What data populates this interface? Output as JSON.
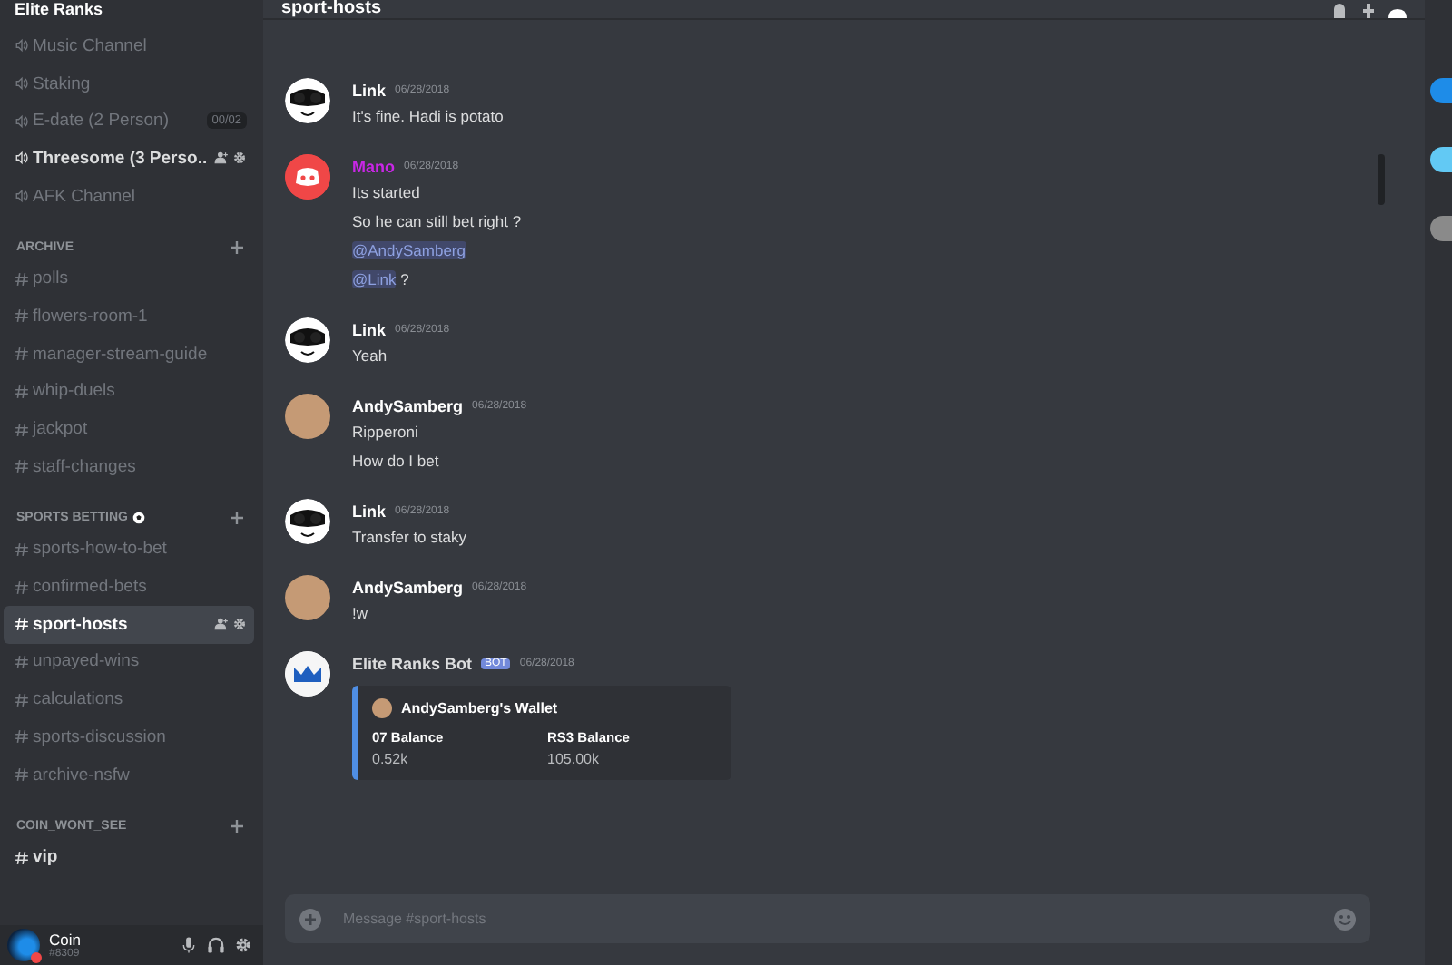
{
  "server": {
    "name": "Elite Ranks"
  },
  "categories": [
    {
      "channels": [
        {
          "kind": "voice",
          "name": "Music Channel",
          "selected": false,
          "bright": false
        },
        {
          "kind": "voice",
          "name": "Staking",
          "selected": false,
          "bright": false
        },
        {
          "kind": "voice",
          "name": "E-date (2 Person)",
          "selected": false,
          "bright": false,
          "count": "00/02"
        },
        {
          "kind": "voice",
          "name": "Threesome (3 Perso..",
          "selected": false,
          "bright": true,
          "tools": true
        },
        {
          "kind": "voice",
          "name": "AFK Channel",
          "selected": false,
          "bright": false
        }
      ]
    },
    {
      "name": "ARCHIVE",
      "channels": [
        {
          "kind": "text",
          "name": "polls",
          "selected": false,
          "bright": false
        },
        {
          "kind": "text",
          "name": "flowers-room-1",
          "selected": false,
          "bright": false
        },
        {
          "kind": "text",
          "name": "manager-stream-guide",
          "selected": false,
          "bright": false
        },
        {
          "kind": "text",
          "name": "whip-duels",
          "selected": false,
          "bright": false
        },
        {
          "kind": "text",
          "name": "jackpot",
          "selected": false,
          "bright": false
        },
        {
          "kind": "text",
          "name": "staff-changes",
          "selected": false,
          "bright": false
        }
      ]
    },
    {
      "name": "SPORTS BETTING",
      "ball": true,
      "channels": [
        {
          "kind": "text",
          "name": "sports-how-to-bet",
          "selected": false,
          "bright": false
        },
        {
          "kind": "text",
          "name": "confirmed-bets",
          "selected": false,
          "bright": false
        },
        {
          "kind": "text",
          "name": "sport-hosts",
          "selected": true,
          "bright": true,
          "tools": true
        },
        {
          "kind": "text",
          "name": "unpayed-wins",
          "selected": false,
          "bright": false
        },
        {
          "kind": "text",
          "name": "calculations",
          "selected": false,
          "bright": false
        },
        {
          "kind": "text",
          "name": "sports-discussion",
          "selected": false,
          "bright": false
        },
        {
          "kind": "text",
          "name": "archive-nsfw",
          "selected": false,
          "bright": false
        }
      ]
    },
    {
      "name": "COIN_WONT_SEE",
      "channels": [
        {
          "kind": "text",
          "name": "vip",
          "selected": false,
          "bright": true
        }
      ]
    }
  ],
  "user": {
    "name": "Coin",
    "tag": "#8309"
  },
  "channel_header": {
    "title": "sport-hosts"
  },
  "messages": [
    {
      "kind": "panda",
      "author": "Link",
      "color": "#ffffff",
      "time": "06/28/2018",
      "lines": [
        [
          {
            "text": "It's fine. Hadi is potato",
            "mention": false
          }
        ]
      ]
    },
    {
      "kind": "discord",
      "author": "Mano",
      "color": "#c927e6",
      "time": "06/28/2018",
      "lines": [
        [
          {
            "text": "Its started",
            "mention": false
          }
        ],
        [
          {
            "text": "So he can still bet right ?",
            "mention": false
          }
        ],
        [
          {
            "text": "@AndySamberg",
            "mention": true
          }
        ],
        [
          {
            "text": "@Link",
            "mention": true
          },
          {
            "text": " ?",
            "mention": false
          }
        ]
      ]
    },
    {
      "kind": "panda",
      "author": "Link",
      "color": "#ffffff",
      "time": "06/28/2018",
      "lines": [
        [
          {
            "text": "Yeah",
            "mention": false
          }
        ]
      ]
    },
    {
      "kind": "photo",
      "author": "AndySamberg",
      "color": "#ffffff",
      "time": "06/28/2018",
      "lines": [
        [
          {
            "text": "Ripperoni",
            "mention": false
          }
        ],
        [
          {
            "text": "How do I bet",
            "mention": false
          }
        ]
      ]
    },
    {
      "kind": "panda",
      "author": "Link",
      "color": "#ffffff",
      "time": "06/28/2018",
      "lines": [
        [
          {
            "text": "Transfer to staky",
            "mention": false
          }
        ]
      ]
    },
    {
      "kind": "photo",
      "author": "AndySamberg",
      "color": "#ffffff",
      "time": "06/28/2018",
      "lines": [
        [
          {
            "text": "!w",
            "mention": false
          }
        ]
      ]
    },
    {
      "kind": "crown",
      "author": "Elite Ranks Bot",
      "color": "#dcddde",
      "bot_tag": "BOT",
      "time": "06/28/2018",
      "embed": {
        "author": "AndySamberg's Wallet",
        "fields": [
          {
            "name": "07 Balance",
            "value": "0.52k"
          },
          {
            "name": "RS3 Balance",
            "value": "105.00k"
          }
        ]
      }
    }
  ],
  "composer": {
    "placeholder": "Message #sport-hosts"
  }
}
